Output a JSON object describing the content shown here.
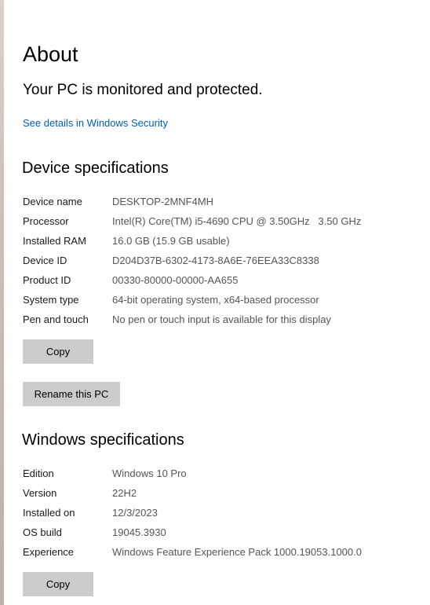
{
  "page": {
    "title": "About",
    "protection_status": "Your PC is monitored and protected.",
    "security_link": "See details in Windows Security"
  },
  "device_specs": {
    "title": "Device specifications",
    "rows": [
      {
        "label": "Device name",
        "value": "DESKTOP-2MNF4MH"
      },
      {
        "label": "Processor",
        "value": "Intel(R) Core(TM) i5-4690 CPU @ 3.50GHz   3.50 GHz"
      },
      {
        "label": "Installed RAM",
        "value": "16.0 GB (15.9 GB usable)"
      },
      {
        "label": "Device ID",
        "value": "D204D37B-6302-4173-8A6E-76EEA33C8338"
      },
      {
        "label": "Product ID",
        "value": "00330-80000-00000-AA655"
      },
      {
        "label": "System type",
        "value": "64-bit operating system, x64-based processor"
      },
      {
        "label": "Pen and touch",
        "value": "No pen or touch input is available for this display"
      }
    ],
    "copy_label": "Copy",
    "rename_label": "Rename this PC"
  },
  "windows_specs": {
    "title": "Windows specifications",
    "rows": [
      {
        "label": "Edition",
        "value": "Windows 10 Pro"
      },
      {
        "label": "Version",
        "value": "22H2"
      },
      {
        "label": "Installed on",
        "value": "12/3/2023"
      },
      {
        "label": "OS build",
        "value": "19045.3930"
      },
      {
        "label": "Experience",
        "value": "Windows Feature Experience Pack 1000.19053.1000.0"
      }
    ],
    "copy_label": "Copy"
  }
}
